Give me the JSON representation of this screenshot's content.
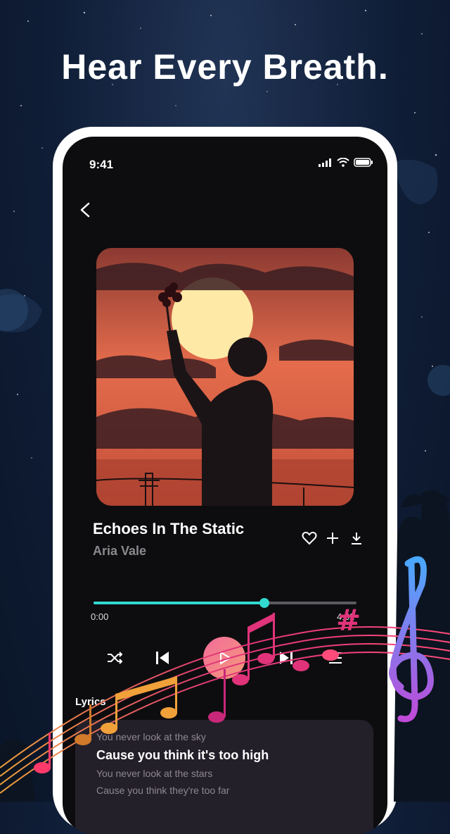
{
  "headline": "Hear Every Breath.",
  "status": {
    "time": "9:41"
  },
  "song": {
    "title": "Echoes In The Static",
    "artist": "Aria Vale"
  },
  "player": {
    "elapsed": "0:00",
    "duration": "4:32",
    "progress": 0.65
  },
  "lyrics": {
    "label": "Lyrics",
    "lines": [
      {
        "text": "You never look at the sky",
        "active": false
      },
      {
        "text": "Cause you think it's too high",
        "active": true
      },
      {
        "text": "You never look at the stars",
        "active": false
      },
      {
        "text": "Cause you think they're too far",
        "active": false
      }
    ]
  },
  "icons": {
    "back": "chevron-left-icon",
    "like": "heart-icon",
    "add": "plus-icon",
    "download": "download-icon",
    "shuffle": "shuffle-icon",
    "prev": "skip-back-icon",
    "play": "play-icon",
    "next": "skip-forward-icon",
    "queue": "queue-icon"
  },
  "colors": {
    "accent": "#32d9d0",
    "play_gradient_start": "#f36b9a",
    "play_gradient_end": "#f49a7a",
    "screen_bg": "#0d0d0f"
  }
}
